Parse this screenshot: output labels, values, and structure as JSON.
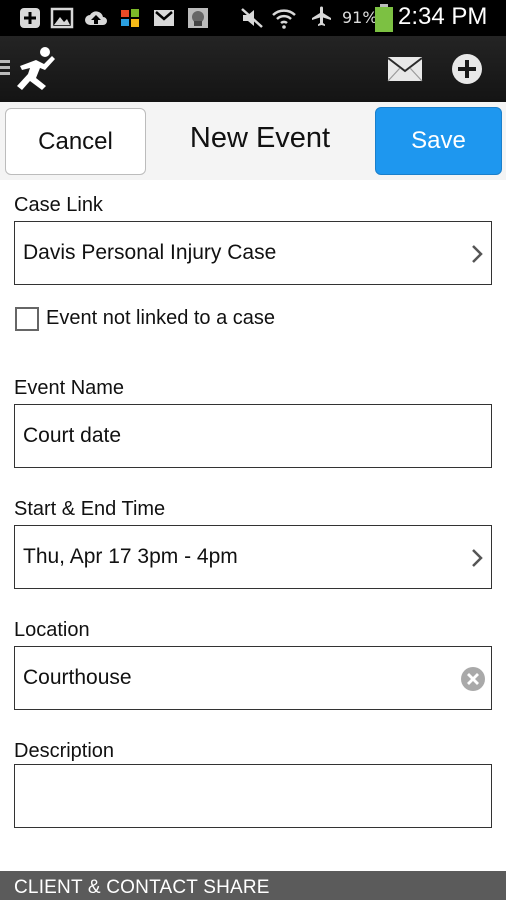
{
  "status_bar": {
    "battery": "91%",
    "time": "2:34 PM"
  },
  "app_bar": {
    "logo": "app-logo-icon",
    "actions": [
      "mail-icon",
      "add-icon"
    ]
  },
  "header": {
    "cancel_label": "Cancel",
    "title": "New Event",
    "save_label": "Save"
  },
  "form": {
    "case_link": {
      "label": "Case Link",
      "value": "Davis Personal Injury Case"
    },
    "not_linked": {
      "label": "Event not linked to a case",
      "checked": false
    },
    "event_name": {
      "label": "Event Name",
      "value": "Court date"
    },
    "time": {
      "label": "Start & End Time",
      "value": "Thu, Apr 17 3pm - 4pm"
    },
    "location": {
      "label": "Location",
      "value": "Courthouse"
    },
    "description": {
      "label": "Description",
      "value": ""
    }
  },
  "section": {
    "title": "CLIENT & CONTACT SHARE"
  },
  "colors": {
    "accent": "#1e97ef",
    "section_bar": "#5b5b5b"
  }
}
